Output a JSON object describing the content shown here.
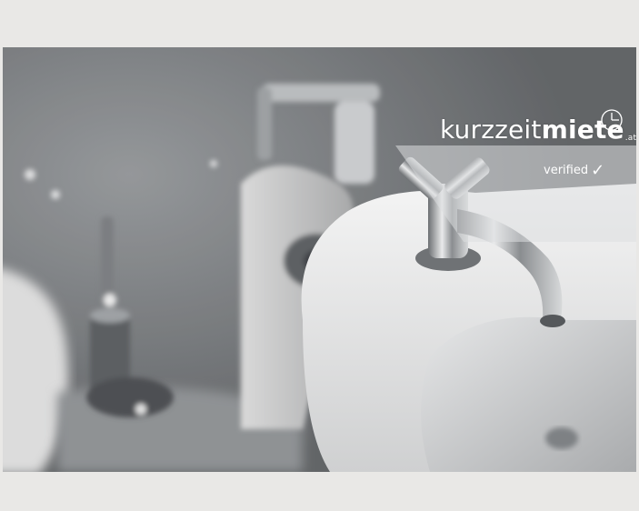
{
  "badge": {
    "brand_part1": "kurzzeit",
    "brand_part2": "miete",
    "brand_tld": ".at",
    "verified_label": "verified",
    "check_glyph": "✓"
  },
  "icons": {
    "clock": "clock-icon",
    "check": "checkmark-icon"
  },
  "colors": {
    "letterbox": "#e9e8e6",
    "badge_text": "#ffffff"
  }
}
